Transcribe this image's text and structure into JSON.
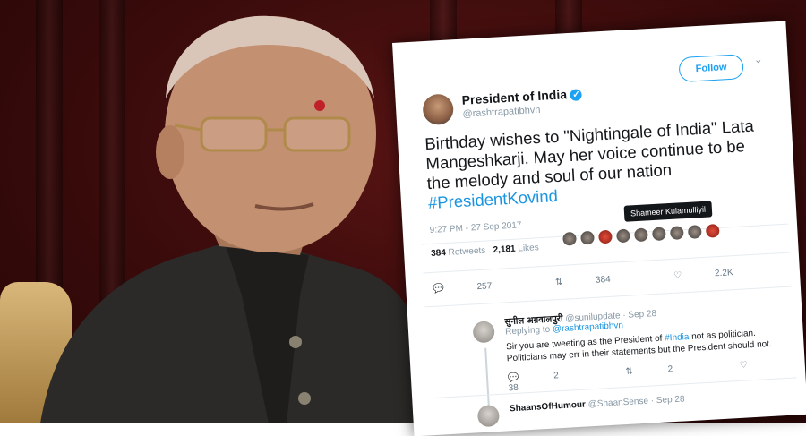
{
  "tweet": {
    "display_name": "President of India",
    "verified_mark": "✓",
    "handle": "@rashtrapatibhvn",
    "follow_label": "Follow",
    "menu_glyph": "⌄",
    "text_line1": "Birthday wishes to \"Nightingale of India\" Lata",
    "text_line2": "Mangeshkarji. May her voice continue to be",
    "text_line3": "the melody and soul of our nation",
    "hashtag": "#PresidentKovind",
    "timestamp": "9:27 PM - 27 Sep 2017",
    "retweets_count": "384",
    "retweets_label": "Retweets",
    "likes_count": "2,181",
    "likes_label": "Likes",
    "tooltip_name": "Shameer Kulamulliyil",
    "action_replies": "257",
    "action_retweets": "384",
    "action_likes": "2.2K"
  },
  "replies": [
    {
      "name": "सुनील अग्रवालपुरी",
      "handle": "@sunilupdate · Sep 28",
      "replying_prefix": "Replying to",
      "replying_to": "@rashtrapatibhvn",
      "text_line1": "Sir you are tweeting as the President of",
      "text_line1_link": "#India",
      "text_line1_rest": "not as politician. Politicians may err",
      "text_line2": "in their statements but the President should not.",
      "replies": "2",
      "retweets": "2",
      "likes": "38"
    },
    {
      "name": "ShaansOfHumour",
      "handle": "@ShaanSense · Sep 28"
    }
  ],
  "colors": {
    "accent": "#1da1f2",
    "background": "#3e0c0c",
    "card": "#ffffff"
  },
  "icons": [
    "reply-icon",
    "retweet-icon",
    "like-icon",
    "verified-icon",
    "chevron-down-icon"
  ]
}
